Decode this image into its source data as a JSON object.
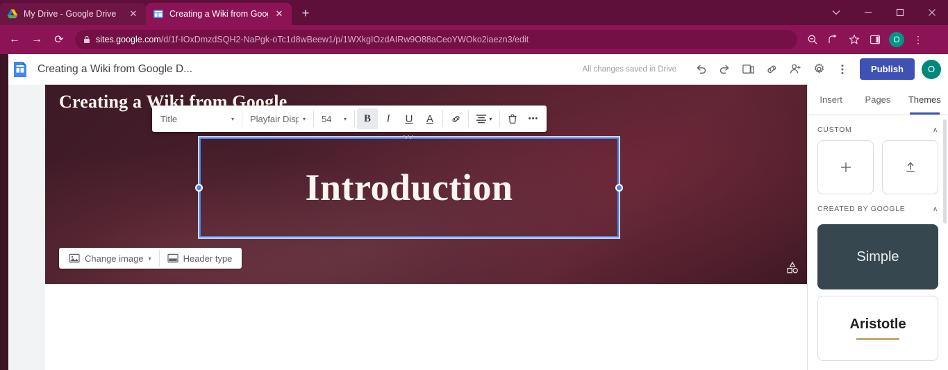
{
  "browser": {
    "tabs": [
      {
        "title": "My Drive - Google Drive",
        "favicon": "google-drive-icon",
        "active": false,
        "close": "✕"
      },
      {
        "title": "Creating a Wiki from Google Doc",
        "favicon": "google-sites-icon",
        "active": true,
        "close": "✕"
      }
    ],
    "new_tab_label": "+",
    "window_controls": {
      "tab_search": "⌄",
      "minimize": "—",
      "maximize": "❐",
      "close": "✕"
    },
    "nav": {
      "back": "←",
      "forward": "→",
      "reload": "⟳"
    },
    "url": {
      "lock": "🔒",
      "host": "sites.google.com",
      "path": "/d/1f-IOxDmzdSQH2-NaPgk-oTc1d8wBeew1/p/1WXkgIOzdAIRw9O88aCeoYWOko2iaezn3/edit",
      "full": "sites.google.com/d/1f-IOxDmzdSQH2-NaPgk-oTc1d8wBeew1/p/1WXkgIOzdAIRw9O88aCeoYWOko2iaezn3/edit"
    },
    "toolbar_icons": [
      "zoom-out-icon",
      "share-icon",
      "bookmark-star-icon",
      "side-panel-icon"
    ],
    "profile_initial": "O",
    "more_menu": "⋮",
    "theme_color": "#8c1456",
    "tabstrip_color": "#5e0f3a"
  },
  "app": {
    "icon": "google-sites-icon",
    "doc_title": "Creating a Wiki from Google D...",
    "save_status": "All changes saved in Drive",
    "toolbar": [
      {
        "name": "undo-icon",
        "label": "Undo"
      },
      {
        "name": "redo-icon",
        "label": "Redo"
      },
      {
        "name": "preview-icon",
        "label": "Preview"
      },
      {
        "name": "link-icon",
        "label": "Copy page link"
      },
      {
        "name": "add-editor-icon",
        "label": "Add editors"
      },
      {
        "name": "settings-gear-icon",
        "label": "Settings"
      },
      {
        "name": "more-vert-icon",
        "label": "More"
      }
    ],
    "publish_label": "Publish",
    "avatar_initial": "O",
    "publish_color": "#3f51b5",
    "avatar_color": "#00897b"
  },
  "format_toolbar": {
    "style": {
      "value": "Title",
      "caret": "▾"
    },
    "font": {
      "value": "Playfair Disp",
      "caret": "▾"
    },
    "size": {
      "value": "54",
      "caret": "▾"
    },
    "bold": {
      "label": "B",
      "active": true
    },
    "italic": {
      "label": "I",
      "active": false
    },
    "underline": {
      "label": "U",
      "active": false
    },
    "text_color": {
      "label": "A",
      "active": false
    },
    "link": {
      "name": "link-icon"
    },
    "align": {
      "name": "align-icon",
      "caret": "▾"
    },
    "delete": {
      "name": "trash-icon"
    },
    "more": {
      "label": "•••"
    }
  },
  "hero": {
    "site_title": "Creating a Wiki from Google",
    "textbox_text": "Introduction",
    "delete_button": "trash-icon",
    "change_image_label": "Change image",
    "change_image_caret": "▾",
    "header_type_label": "Header type",
    "watermark": "sites-shapes-icon",
    "background_color": "#4a1f2c"
  },
  "panel": {
    "tabs": [
      {
        "label": "Insert",
        "active": false
      },
      {
        "label": "Pages",
        "active": false
      },
      {
        "label": "Themes",
        "active": true
      }
    ],
    "sections": [
      {
        "title": "CUSTOM",
        "chevron": "∧"
      },
      {
        "title": "CREATED BY GOOGLE",
        "chevron": "∧"
      }
    ],
    "custom_cards": [
      {
        "name": "add-theme-button",
        "glyph": "+"
      },
      {
        "name": "upload-theme-button",
        "glyph": "⇧"
      }
    ],
    "themes": [
      {
        "label": "Simple",
        "color": "#37474f",
        "selected": true
      },
      {
        "label": "Aristotle",
        "color": "#ffffff",
        "selected": false
      }
    ]
  }
}
